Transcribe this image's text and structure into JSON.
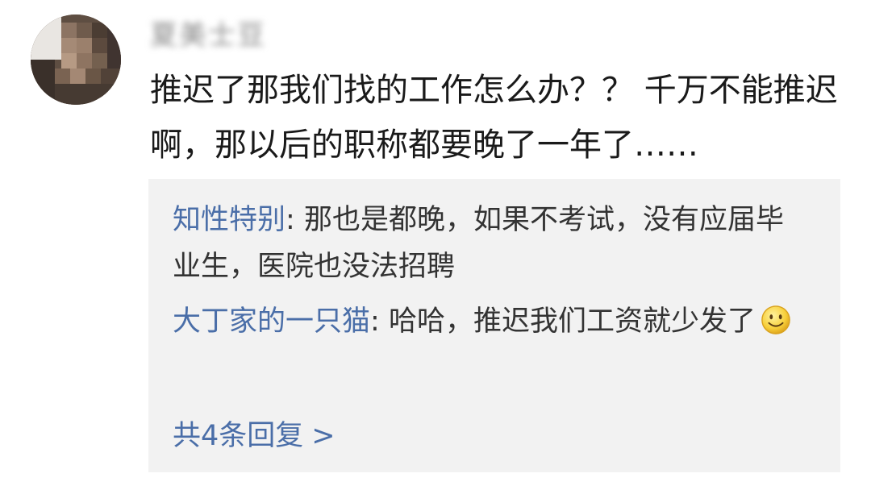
{
  "comment": {
    "username": "夏美士豆",
    "text": "推迟了那我们找的工作怎么办？？ 千万不能推迟啊，那以后的职称都要晚了一年了……"
  },
  "replies": [
    {
      "author": "知性特别",
      "separator": ": ",
      "text": "那也是都晚，如果不考试，没有应届毕业生，医院也没法招聘"
    },
    {
      "author": "大丁家的一只猫",
      "separator": ": ",
      "text": "哈哈，推迟我们工资就少发了",
      "emoji": "smile-emoji"
    }
  ],
  "more_replies": {
    "label": "共4条回复",
    "chevron": ">"
  },
  "colors": {
    "link": "#4a6ea8",
    "reply_background": "#f2f2f2",
    "text": "#1a1a1a"
  }
}
